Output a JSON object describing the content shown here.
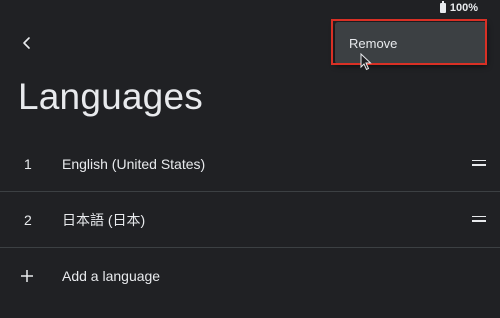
{
  "status": {
    "battery_percent": "100%"
  },
  "header": {
    "back_icon": "chevron-left-icon",
    "title": "Languages"
  },
  "context_menu": {
    "items": [
      {
        "label": "Remove"
      }
    ]
  },
  "languages": [
    {
      "index": "1",
      "name": "English (United States)"
    },
    {
      "index": "2",
      "name": "日本語 (日本)"
    }
  ],
  "add_language": {
    "label": "Add a language",
    "icon": "plus-icon"
  },
  "colors": {
    "background": "#202124",
    "menu_background": "#3c4043",
    "highlight": "#d93025",
    "text": "#e8eaed"
  }
}
